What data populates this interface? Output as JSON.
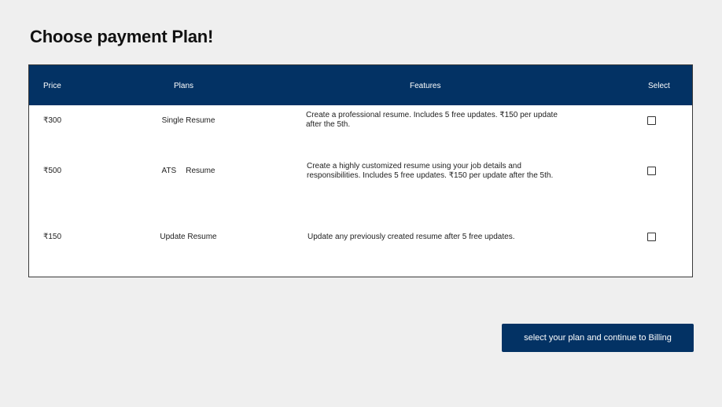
{
  "page": {
    "title": "Choose payment Plan!"
  },
  "table": {
    "headers": {
      "price": "Price",
      "plans": "Plans",
      "features": "Features",
      "select": "Select"
    },
    "rows": [
      {
        "price": "₹300",
        "plan": "Single Resume",
        "features": "Create a professional resume. Includes 5 free updates. ₹150 per update after the 5th.",
        "selected": false
      },
      {
        "price": "₹500",
        "plan_word_1": "ATS",
        "plan_word_2": "Resume",
        "features": "Create a highly customized resume using your job details and responsibilities. Includes 5 free updates. ₹150 per update after the 5th.",
        "selected": false
      },
      {
        "price": "₹150",
        "plan": "Update Resume",
        "features": "Update any previously created resume after 5 free updates.",
        "selected": false
      }
    ]
  },
  "continue_button": {
    "label": "select your plan and continue to Billing"
  },
  "colors": {
    "accent": "#033264",
    "background": "#efefef"
  }
}
